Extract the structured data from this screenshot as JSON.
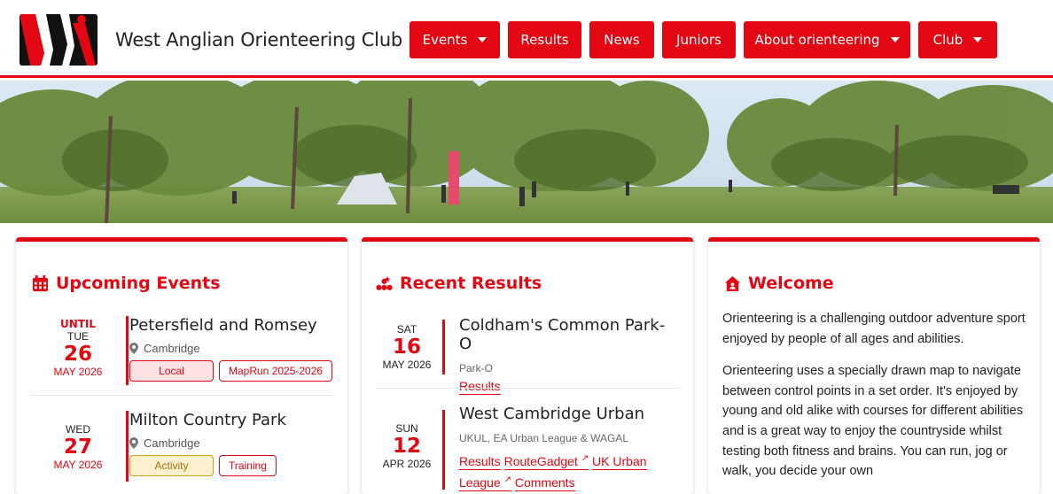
{
  "header": {
    "site_title": "West Anglian Orienteering Club",
    "nav": [
      {
        "label": "Events",
        "dropdown": true
      },
      {
        "label": "Results",
        "dropdown": false
      },
      {
        "label": "News",
        "dropdown": false
      },
      {
        "label": "Juniors",
        "dropdown": false
      },
      {
        "label": "About orienteering",
        "dropdown": true
      },
      {
        "label": "Club",
        "dropdown": true
      }
    ],
    "accent_color": "#e30613"
  },
  "upcoming": {
    "title": "Upcoming Events",
    "icon": "calendar-icon",
    "events": [
      {
        "until": "UNTIL",
        "dow": "TUE",
        "day": "26",
        "month": "MAY 2026",
        "name": "Petersfield and Romsey",
        "location": "Cambridge",
        "tags": [
          "Local",
          "MapRun 2025-2026"
        ]
      },
      {
        "until": "",
        "dow": "WED",
        "day": "27",
        "month": "MAY 2026",
        "name": "Milton Country Park",
        "location": "Cambridge",
        "tags": [
          "Activity",
          "Training"
        ]
      }
    ]
  },
  "results": {
    "title": "Recent Results",
    "icon": "podium-icon",
    "items": [
      {
        "dow": "SAT",
        "day": "16",
        "month": "MAY 2026",
        "name": "Coldham's Common Park-O",
        "subtitle": "Park-O",
        "links": [
          "Results"
        ]
      },
      {
        "dow": "SUN",
        "day": "12",
        "month": "APR 2026",
        "name": "West Cambridge Urban",
        "subtitle": "UKUL, EA Urban League & WAGAL",
        "links": [
          "Results",
          "RouteGadget",
          "UK Urban League",
          "Comments"
        ]
      }
    ]
  },
  "welcome": {
    "title": "Welcome",
    "icon": "house-icon",
    "paragraphs": [
      "Orienteering is a challenging outdoor adventure sport enjoyed by people of all ages and abilities.",
      "Orienteering uses a specially drawn map to navigate between control points in a set order. It's enjoyed by young and old alike with courses for different abilities and is a great way to enjoy the countryside whilst testing both fitness and brains. You can run, jog or walk, you decide your own"
    ]
  }
}
